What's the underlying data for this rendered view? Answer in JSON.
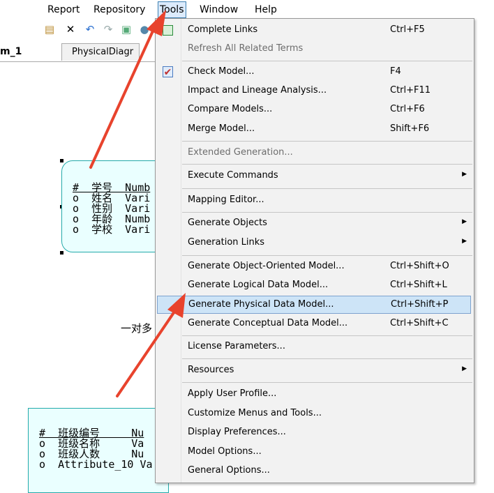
{
  "menubar": {
    "items": [
      "Report",
      "Repository",
      "Tools",
      "Window",
      "Help"
    ]
  },
  "tabs": {
    "tab1": "m_1",
    "tab2": "PhysicalDiagr"
  },
  "entity1": {
    "rows": [
      "#  学号  Numb",
      "o  姓名  Vari",
      "o  性别  Vari",
      "o  年龄  Numb",
      "o  学校  Vari"
    ]
  },
  "relation_label": "一对多",
  "entity2": {
    "rows": [
      "#  班级编号     Nu",
      "o  班级名称     Va",
      "o  班级人数     Nu",
      "o  Attribute_10 Va"
    ]
  },
  "tools_menu": {
    "items": [
      {
        "label": "Complete Links",
        "shortcut": "Ctrl+F5"
      },
      {
        "label": "Refresh All Related Terms",
        "shortcut": ""
      },
      {
        "label": "Check Model...",
        "shortcut": "F4"
      },
      {
        "label": "Impact and Lineage Analysis...",
        "shortcut": "Ctrl+F11"
      },
      {
        "label": "Compare Models...",
        "shortcut": "Ctrl+F6"
      },
      {
        "label": "Merge Model...",
        "shortcut": "Shift+F6"
      },
      {
        "label": "Extended Generation...",
        "shortcut": ""
      },
      {
        "label": "Execute Commands",
        "shortcut": ""
      },
      {
        "label": "Mapping Editor...",
        "shortcut": ""
      },
      {
        "label": "Generate Objects",
        "shortcut": ""
      },
      {
        "label": "Generation Links",
        "shortcut": ""
      },
      {
        "label": "Generate Object-Oriented Model...",
        "shortcut": "Ctrl+Shift+O"
      },
      {
        "label": "Generate Logical Data Model...",
        "shortcut": "Ctrl+Shift+L"
      },
      {
        "label": "Generate Physical Data Model...",
        "shortcut": "Ctrl+Shift+P"
      },
      {
        "label": "Generate Conceptual Data Model...",
        "shortcut": "Ctrl+Shift+C"
      },
      {
        "label": "License Parameters...",
        "shortcut": ""
      },
      {
        "label": "Resources",
        "shortcut": ""
      },
      {
        "label": "Apply User Profile...",
        "shortcut": ""
      },
      {
        "label": "Customize Menus and Tools...",
        "shortcut": ""
      },
      {
        "label": "Display Preferences...",
        "shortcut": ""
      },
      {
        "label": "Model Options...",
        "shortcut": ""
      },
      {
        "label": "General Options...",
        "shortcut": ""
      }
    ]
  },
  "colors": {
    "highlight": "#cde4f7",
    "arrow": "#e8432d",
    "entity_fill": "#eaffff"
  }
}
